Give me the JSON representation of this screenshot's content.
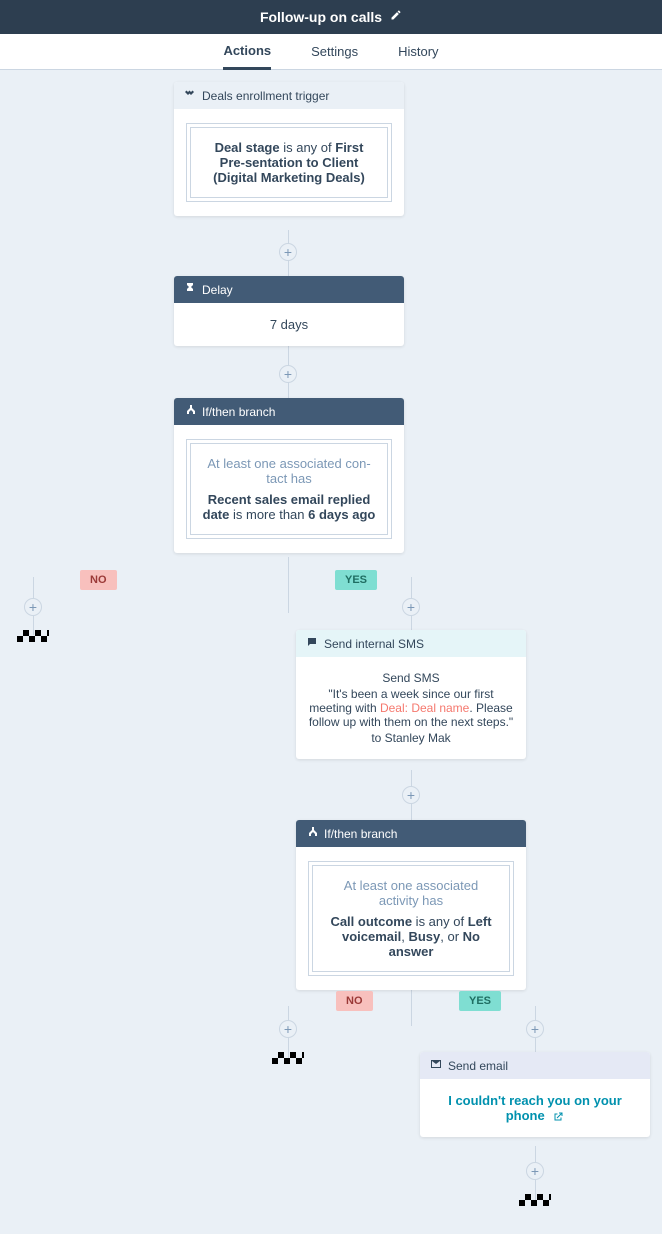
{
  "header": {
    "title": "Follow-up on calls"
  },
  "tabs": {
    "actions": "Actions",
    "settings": "Settings",
    "history": "History"
  },
  "enrollment": {
    "header": "Deals enrollment trigger",
    "line1_pre": "Deal stage",
    "line1_post": " is any of ",
    "line1_bold": "First Pre-sentation to Client (Digital Marketing Deals)"
  },
  "delay": {
    "header": "Delay",
    "value": "7 days"
  },
  "branch1": {
    "header": "If/then branch",
    "intro": "At least one associated con-tact has",
    "bold1": "Recent sales email replied date",
    "mid": " is more than ",
    "bold2": "6 days ago"
  },
  "badges": {
    "no": "NO",
    "yes": "YES"
  },
  "sms": {
    "header": "Send internal SMS",
    "title": "Send SMS",
    "quote_pre": "\"It's been a week since our first meeting with ",
    "deal_token": "Deal: Deal name",
    "quote_post": ". Please follow up with them on the next steps.\"",
    "to_pre": "to ",
    "to_name": "Stanley Mak"
  },
  "branch2": {
    "header": "If/then branch",
    "intro": "At least one associated activity has",
    "bold1": "Call outcome",
    "mid1": " is any of ",
    "v1": "Left voicemail",
    "mid2": ", ",
    "v2": "Busy",
    "mid3": ", or ",
    "v3": "No answer"
  },
  "email": {
    "header": "Send email",
    "link": "I couldn't reach you on your phone"
  }
}
